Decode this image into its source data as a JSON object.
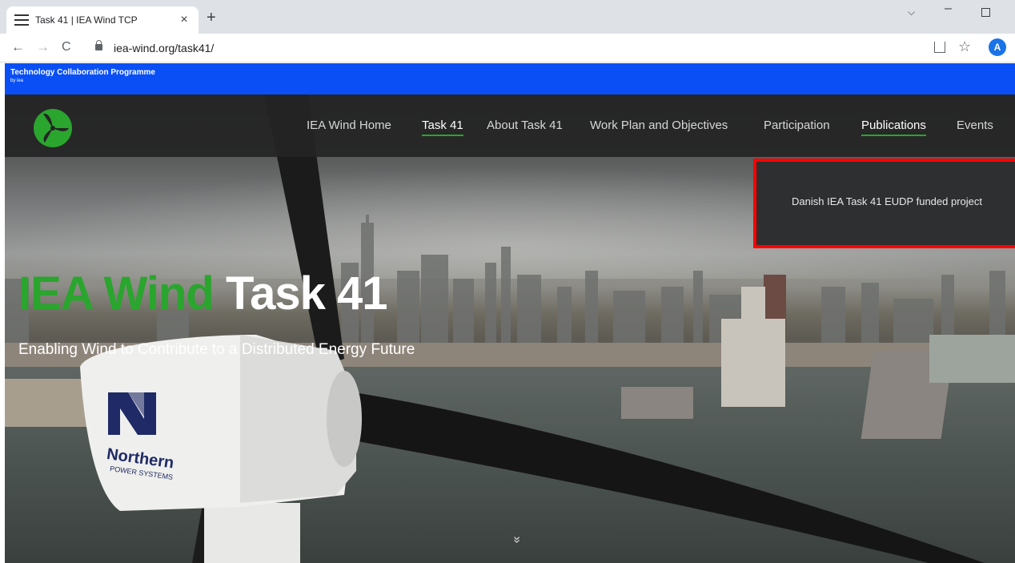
{
  "browser": {
    "tab_title": "Task 41 | IEA Wind TCP",
    "tab_close": "×",
    "new_tab": "+",
    "url": "iea-wind.org/task41/",
    "back": "←",
    "forward": "→",
    "reload": "C",
    "star": "☆",
    "avatar_letter": "A",
    "chevron": "⌵",
    "minimize": "–"
  },
  "banner": {
    "title": "Technology Collaboration Programme",
    "subtitle": "by iea"
  },
  "nav": {
    "items": [
      {
        "label": "IEA Wind Home",
        "active": false
      },
      {
        "label": "Task 41",
        "active": true
      },
      {
        "label": "About Task 41",
        "active": false
      },
      {
        "label": "Work Plan and Objectives",
        "active": false
      },
      {
        "label": "Participation",
        "active": false
      },
      {
        "label": "Publications",
        "active": true
      },
      {
        "label": "Events",
        "active": false
      }
    ]
  },
  "dropdown": {
    "items": [
      {
        "label": "Danish IEA Task 41 EUDP funded project"
      }
    ]
  },
  "hero": {
    "title_green": "IEA Wind",
    "title_white": "Task 41",
    "subtitle": "Enabling Wind to Contribute to a Distributed Energy Future",
    "scroll_hint": "»"
  },
  "turbine": {
    "brand": "Northern",
    "brand_sub": "POWER SYSTEMS"
  },
  "colors": {
    "brand_green": "#2aa52e",
    "banner_blue": "#0a4ff5",
    "highlight_red": "#ff0000"
  }
}
